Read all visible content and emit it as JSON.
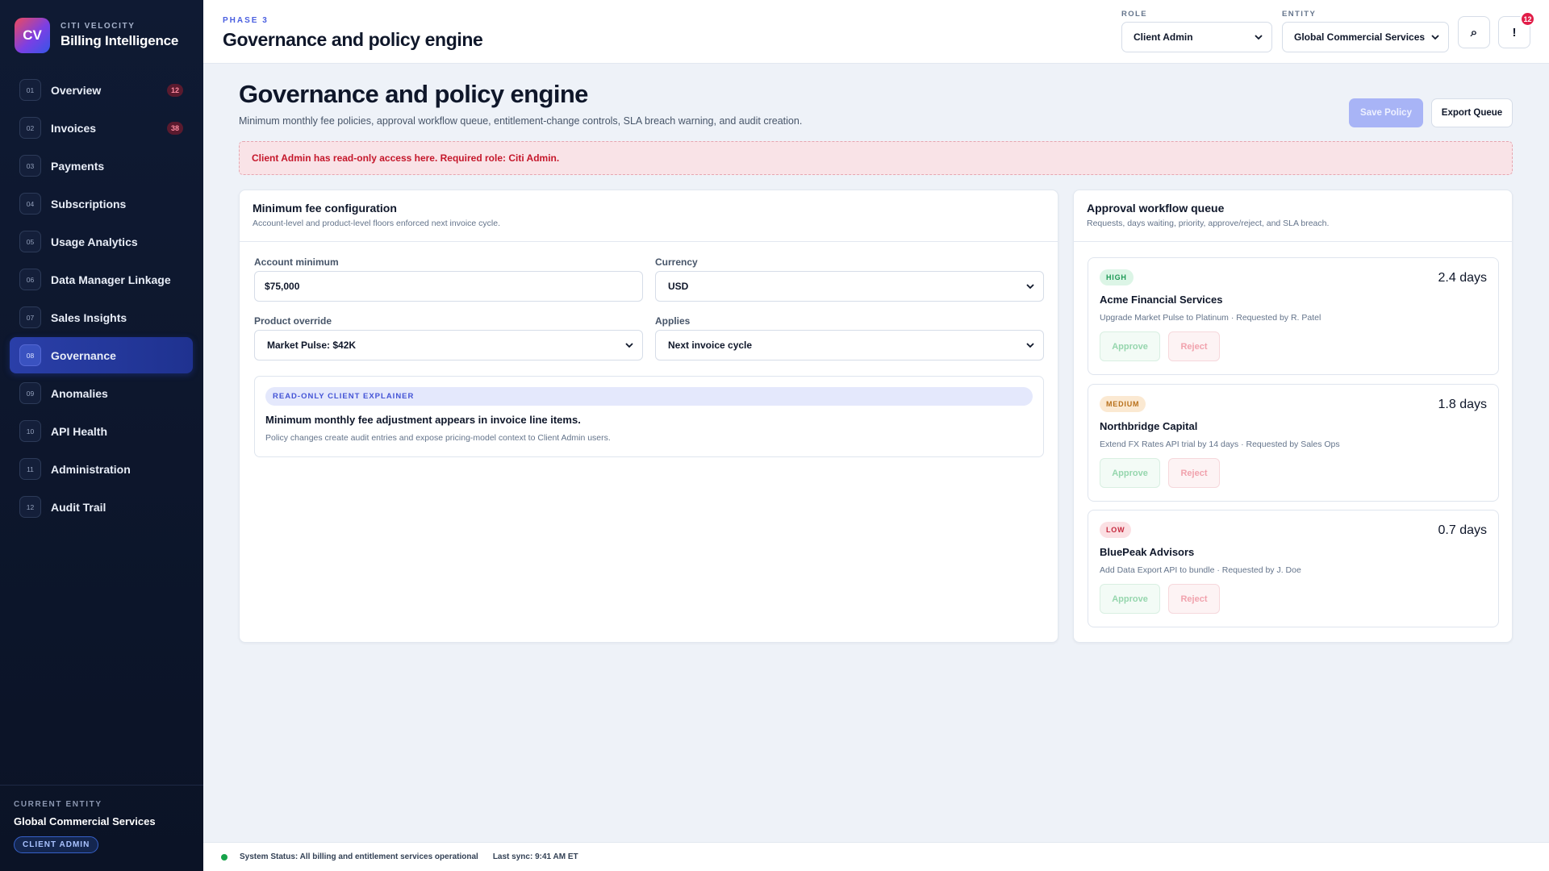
{
  "brand": {
    "logo": "CV",
    "sub": "CITI VELOCITY",
    "title": "Billing Intelligence"
  },
  "nav": [
    {
      "num": "01",
      "label": "Overview",
      "badge": "12"
    },
    {
      "num": "02",
      "label": "Invoices",
      "badge": "38"
    },
    {
      "num": "03",
      "label": "Payments",
      "badge": ""
    },
    {
      "num": "04",
      "label": "Subscriptions",
      "badge": ""
    },
    {
      "num": "05",
      "label": "Usage Analytics",
      "badge": ""
    },
    {
      "num": "06",
      "label": "Data Manager Linkage",
      "badge": ""
    },
    {
      "num": "07",
      "label": "Sales Insights",
      "badge": ""
    },
    {
      "num": "08",
      "label": "Governance",
      "badge": "",
      "active": true
    },
    {
      "num": "09",
      "label": "Anomalies",
      "badge": ""
    },
    {
      "num": "10",
      "label": "API Health",
      "badge": ""
    },
    {
      "num": "11",
      "label": "Administration",
      "badge": ""
    },
    {
      "num": "12",
      "label": "Audit Trail",
      "badge": ""
    }
  ],
  "sidebar_footer": {
    "label": "CURRENT ENTITY",
    "entity": "Global Commercial Services",
    "role": "CLIENT ADMIN"
  },
  "topbar": {
    "phase": "PHASE 3",
    "title": "Governance and policy engine",
    "role_label": "ROLE",
    "role_value": "Client Admin",
    "entity_label": "ENTITY",
    "entity_value": "Global Commercial Services",
    "search_glyph": "⌕",
    "alert_glyph": "!",
    "notif_count": "12"
  },
  "page": {
    "title": "Governance and policy engine",
    "description": "Minimum monthly fee policies, approval workflow queue, entitlement-change controls, SLA breach warning, and audit creation.",
    "save_label": "Save Policy",
    "export_label": "Export Queue",
    "alert": "Client Admin has read-only access here. Required role: Citi Admin."
  },
  "min_fee": {
    "title": "Minimum fee configuration",
    "subtitle": "Account-level and product-level floors enforced next invoice cycle.",
    "account_min_label": "Account minimum",
    "account_min_value": "$75,000",
    "currency_label": "Currency",
    "currency_value": "USD",
    "product_override_label": "Product override",
    "product_override_value": "Market Pulse: $42K",
    "applies_label": "Applies",
    "applies_value": "Next invoice cycle",
    "explainer_pill": "READ-ONLY CLIENT EXPLAINER",
    "explainer_title": "Minimum monthly fee adjustment appears in invoice line items.",
    "explainer_text": "Policy changes create audit entries and expose pricing-model context to Client Admin users."
  },
  "queue": {
    "title": "Approval workflow queue",
    "subtitle": "Requests, days waiting, priority, approve/reject, and SLA breach.",
    "approve_label": "Approve",
    "reject_label": "Reject",
    "items": [
      {
        "priority": "HIGH",
        "level": "high",
        "days": "2.4 days",
        "name": "Acme Financial Services",
        "desc": "Upgrade Market Pulse to Platinum · Requested by R. Patel"
      },
      {
        "priority": "MEDIUM",
        "level": "medium",
        "days": "1.8 days",
        "name": "Northbridge Capital",
        "desc": "Extend FX Rates API trial by 14 days · Requested by Sales Ops"
      },
      {
        "priority": "LOW",
        "level": "low",
        "days": "0.7 days",
        "name": "BluePeak Advisors",
        "desc": "Add Data Export API to bundle · Requested by J. Doe"
      }
    ]
  },
  "status": {
    "text": "System Status: All billing and entitlement services operational",
    "sync": "Last sync: 9:41 AM ET"
  },
  "colors": {
    "accent": "#4a5fe0",
    "sidebar_bg": "#0f1a33",
    "alert_text": "#c5172b",
    "status_ok": "#16a34a"
  }
}
